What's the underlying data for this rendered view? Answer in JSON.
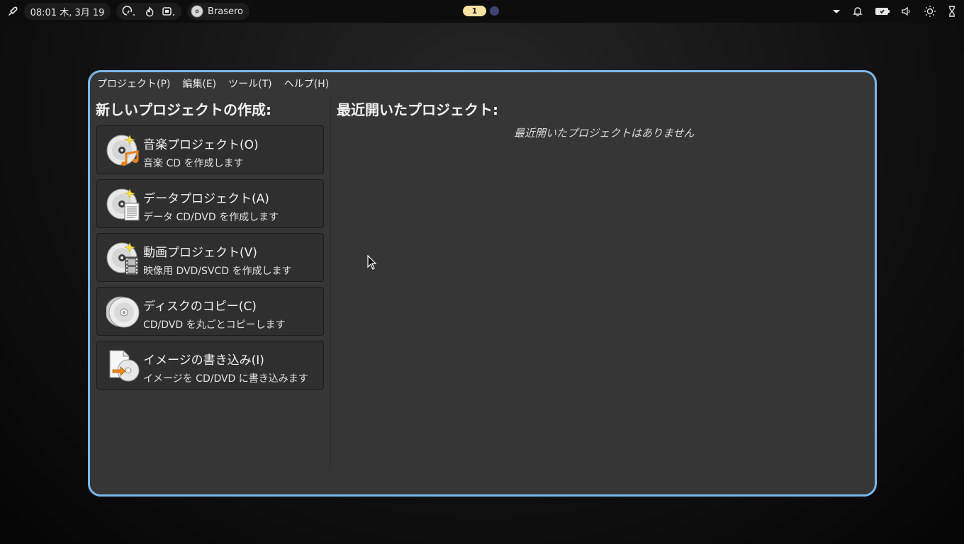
{
  "topbar": {
    "clock": "08:01 木, 3月 19",
    "app_name": "Brasero",
    "workspace": "1",
    "icons": [
      "launcher-icon",
      "cpu-gauge-icon",
      "temperature-icon",
      "memory-icon",
      "disc-app-icon",
      "dropdown-icon",
      "bell-icon",
      "battery-icon",
      "volume-icon",
      "brightness-icon",
      "power-icon"
    ]
  },
  "window": {
    "menu": [
      "プロジェクト(P)",
      "編集(E)",
      "ツール(T)",
      "ヘルプ(H)"
    ],
    "new_heading": "新しいプロジェクトの作成:",
    "recent_heading": "最近開いたプロジェクト:",
    "recent_empty": "最近開いたプロジェクトはありません",
    "projects": [
      {
        "title": "音楽プロジェクト(O)",
        "subtitle": "音楽 CD を作成します",
        "icon": "audio-disc-icon"
      },
      {
        "title": "データプロジェクト(A)",
        "subtitle": "データ CD/DVD を作成します",
        "icon": "data-disc-icon"
      },
      {
        "title": "動画プロジェクト(V)",
        "subtitle": "映像用 DVD/SVCD を作成します",
        "icon": "video-disc-icon"
      },
      {
        "title": "ディスクのコピー(C)",
        "subtitle": "CD/DVD を丸ごとコピーします",
        "icon": "disc-copy-icon"
      },
      {
        "title": "イメージの書き込み(I)",
        "subtitle": "イメージを CD/DVD に書き込みます",
        "icon": "burn-image-icon"
      }
    ]
  },
  "colors": {
    "accent_border": "#7cb7ea",
    "workspace_active": "#f7e3a1",
    "window_bg": "#363636"
  }
}
